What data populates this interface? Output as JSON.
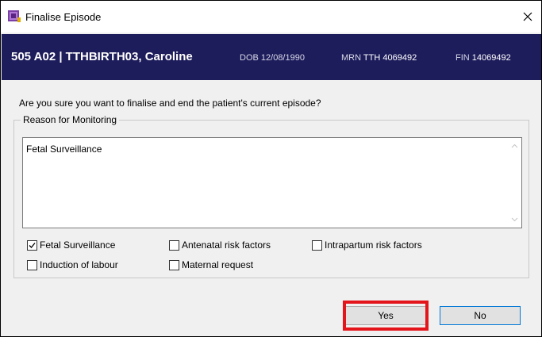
{
  "window": {
    "title": "Finalise Episode",
    "close_glyph": "✕"
  },
  "banner": {
    "bed_and_name": "505 A02 | TTHBIRTH03, Caroline",
    "dob_label": "DOB",
    "dob_value": "12/08/1990",
    "mrn_label": "MRN",
    "mrn_value": "TTH 4069492",
    "fin_label": "FIN",
    "fin_value": "14069492",
    "background_color": "#1e1d5c"
  },
  "question": "Are you sure you want to finalise and end the patient's current episode?",
  "reason_group": {
    "legend": "Reason for Monitoring",
    "text_value": "Fetal Surveillance"
  },
  "checkboxes": {
    "fetal_surveillance": {
      "label": "Fetal Surveillance",
      "checked": true
    },
    "antenatal_risk": {
      "label": "Antenatal risk factors",
      "checked": false
    },
    "intrapartum_risk": {
      "label": "Intrapartum risk factors",
      "checked": false
    },
    "induction_of_labour": {
      "label": "Induction of labour",
      "checked": false
    },
    "maternal_request": {
      "label": "Maternal request",
      "checked": false
    }
  },
  "buttons": {
    "yes_label": "Yes",
    "no_label": "No"
  },
  "annotation_color": "#e4141b"
}
